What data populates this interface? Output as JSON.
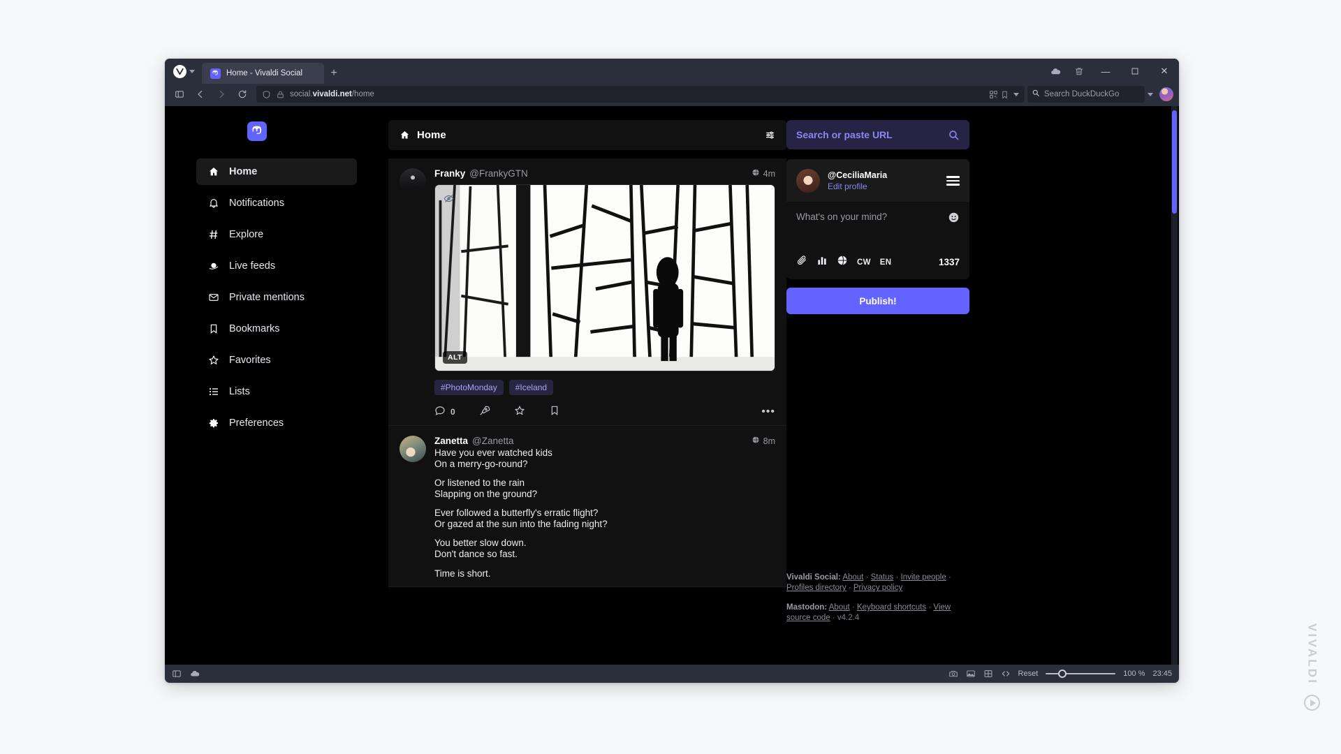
{
  "browser": {
    "vivaldi_menu_icon": "vivaldi-logo-icon",
    "tabs": [
      {
        "title": "Home - Vivaldi Social",
        "favicon": "mastodon-icon",
        "active": true
      }
    ],
    "new_tab_label": "+",
    "window_controls": {
      "sync_icon": "cloud-icon",
      "trash_icon": "trash-icon",
      "minimize_label": "—",
      "maximize_label": "☐",
      "close_label": "✕"
    },
    "address_bar": {
      "panel_toggle_icon": "panel-toggle-icon",
      "back_icon": "back-arrow-icon",
      "forward_icon": "forward-arrow-icon",
      "reload_icon": "reload-icon",
      "shield_icon": "shield-icon",
      "lock_icon": "lock-icon",
      "url_prefix": "social.",
      "url_domain": "vivaldi.net",
      "url_path": "/home",
      "qr_icon": "qr-code-icon",
      "bookmark_icon": "bookmark-icon",
      "dropdown_icon": "chevron-down-icon",
      "search_engine_icon": "search-duckduckgo-icon",
      "search_placeholder": "Search DuckDuckGo",
      "search_dropdown_icon": "chevron-down-icon",
      "profile_icon": "profile-avatar"
    }
  },
  "mastodon": {
    "logo_icon": "mastodon-logo-icon",
    "nav": {
      "items": [
        {
          "label": "Home",
          "icon": "home-icon",
          "active": true
        },
        {
          "label": "Notifications",
          "icon": "bell-icon",
          "active": false
        },
        {
          "label": "Explore",
          "icon": "hashtag-icon",
          "active": false
        },
        {
          "label": "Live feeds",
          "icon": "planet-icon",
          "active": false
        },
        {
          "label": "Private mentions",
          "icon": "envelope-icon",
          "active": false
        },
        {
          "label": "Bookmarks",
          "icon": "bookmark-icon",
          "active": false
        },
        {
          "label": "Favorites",
          "icon": "star-icon",
          "active": false
        },
        {
          "label": "Lists",
          "icon": "list-icon",
          "active": false
        },
        {
          "label": "Preferences",
          "icon": "gear-icon",
          "active": false
        }
      ]
    },
    "feed": {
      "header": {
        "title": "Home",
        "icon": "home-icon",
        "settings_icon": "sliders-icon"
      },
      "posts": [
        {
          "display_name": "Franky",
          "handle": "@FrankyGTN",
          "visibility_icon": "globe-icon",
          "timestamp": "4m",
          "media": {
            "alt_badge": "ALT",
            "hide_icon": "eye-slash-icon",
            "description": "black and white photo of a silhouetted person standing by large angular glass windows"
          },
          "tags": [
            "#PhotoMonday",
            "#Iceland"
          ],
          "actions": {
            "reply_icon": "reply-icon",
            "reply_count": "0",
            "boost_icon": "boost-rocket-icon",
            "favorite_icon": "star-icon",
            "bookmark_icon": "bookmark-icon",
            "more_icon": "more-dots-icon",
            "more_label": "•••"
          }
        },
        {
          "display_name": "Zanetta",
          "handle": "@Zanetta",
          "visibility_icon": "globe-icon",
          "timestamp": "8m",
          "stanzas": [
            [
              "Have you ever watched kids",
              "On a merry-go-round?"
            ],
            [
              "Or listened to the rain",
              "Slapping on the ground?"
            ],
            [
              "Ever followed a butterfly's erratic flight?",
              "Or gazed at the sun into the fading night?"
            ],
            [
              "You better slow down.",
              "Don't dance so fast."
            ],
            [
              "Time is short."
            ]
          ]
        }
      ]
    },
    "right": {
      "search_url": {
        "label": "Search or paste URL",
        "icon": "search-icon"
      },
      "compose": {
        "account_handle": "@CeciliaMaria",
        "edit_profile_label": "Edit profile",
        "menu_icon": "hamburger-menu-icon",
        "placeholder": "What's on your mind?",
        "emoji_icon": "emoji-smiley-icon",
        "tools": [
          {
            "icon": "paperclip-icon",
            "label": ""
          },
          {
            "icon": "poll-chart-icon",
            "label": ""
          },
          {
            "icon": "globe-icon",
            "label": ""
          },
          {
            "icon": "content-warning-icon",
            "label": "CW"
          },
          {
            "icon": "language-icon",
            "label": "EN"
          }
        ],
        "character_counter": "1337",
        "publish_label": "Publish!"
      },
      "footer": {
        "vivaldi_label": "Vivaldi Social:",
        "vivaldi_links": [
          "About",
          "Status",
          "Invite people",
          "Profiles directory",
          "Privacy policy"
        ],
        "mastodon_label": "Mastodon:",
        "mastodon_links": [
          "About",
          "Keyboard shortcuts",
          "View source code"
        ],
        "version": "v4.2.4",
        "separator": "·"
      }
    }
  },
  "status_bar": {
    "left_icons": [
      "panel-toggle-icon",
      "cloud-icon"
    ],
    "right_icons": [
      "camera-icon",
      "image-icon",
      "tiling-icon",
      "developer-code-icon"
    ],
    "reset_label": "Reset",
    "zoom_level": "100 %",
    "clock": "23:45"
  },
  "watermark": {
    "text": "VIVALDI",
    "badge_icon": "play-circle-icon"
  }
}
